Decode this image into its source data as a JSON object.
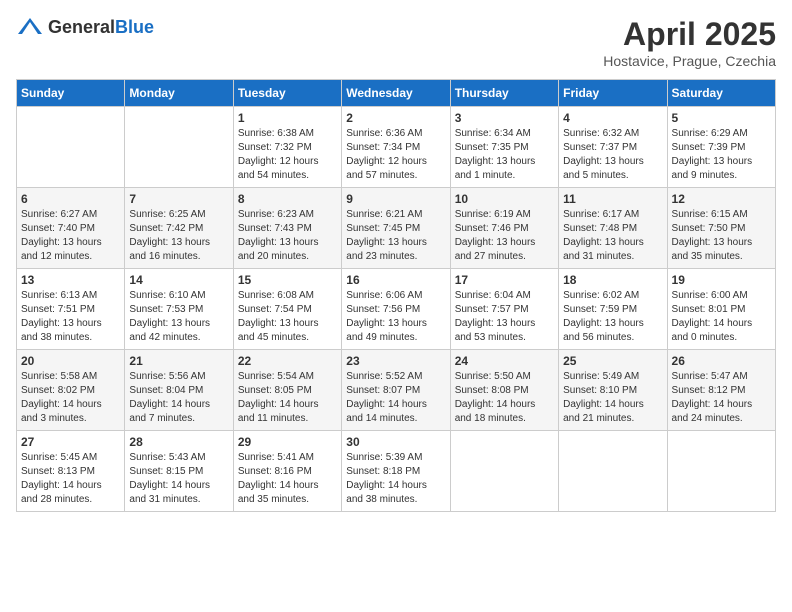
{
  "header": {
    "logo_general": "General",
    "logo_blue": "Blue",
    "main_title": "April 2025",
    "sub_title": "Hostavice, Prague, Czechia"
  },
  "days_of_week": [
    "Sunday",
    "Monday",
    "Tuesday",
    "Wednesday",
    "Thursday",
    "Friday",
    "Saturday"
  ],
  "weeks": [
    [
      {
        "day": "",
        "sunrise": "",
        "sunset": "",
        "daylight": ""
      },
      {
        "day": "",
        "sunrise": "",
        "sunset": "",
        "daylight": ""
      },
      {
        "day": "1",
        "sunrise": "Sunrise: 6:38 AM",
        "sunset": "Sunset: 7:32 PM",
        "daylight": "Daylight: 12 hours and 54 minutes."
      },
      {
        "day": "2",
        "sunrise": "Sunrise: 6:36 AM",
        "sunset": "Sunset: 7:34 PM",
        "daylight": "Daylight: 12 hours and 57 minutes."
      },
      {
        "day": "3",
        "sunrise": "Sunrise: 6:34 AM",
        "sunset": "Sunset: 7:35 PM",
        "daylight": "Daylight: 13 hours and 1 minute."
      },
      {
        "day": "4",
        "sunrise": "Sunrise: 6:32 AM",
        "sunset": "Sunset: 7:37 PM",
        "daylight": "Daylight: 13 hours and 5 minutes."
      },
      {
        "day": "5",
        "sunrise": "Sunrise: 6:29 AM",
        "sunset": "Sunset: 7:39 PM",
        "daylight": "Daylight: 13 hours and 9 minutes."
      }
    ],
    [
      {
        "day": "6",
        "sunrise": "Sunrise: 6:27 AM",
        "sunset": "Sunset: 7:40 PM",
        "daylight": "Daylight: 13 hours and 12 minutes."
      },
      {
        "day": "7",
        "sunrise": "Sunrise: 6:25 AM",
        "sunset": "Sunset: 7:42 PM",
        "daylight": "Daylight: 13 hours and 16 minutes."
      },
      {
        "day": "8",
        "sunrise": "Sunrise: 6:23 AM",
        "sunset": "Sunset: 7:43 PM",
        "daylight": "Daylight: 13 hours and 20 minutes."
      },
      {
        "day": "9",
        "sunrise": "Sunrise: 6:21 AM",
        "sunset": "Sunset: 7:45 PM",
        "daylight": "Daylight: 13 hours and 23 minutes."
      },
      {
        "day": "10",
        "sunrise": "Sunrise: 6:19 AM",
        "sunset": "Sunset: 7:46 PM",
        "daylight": "Daylight: 13 hours and 27 minutes."
      },
      {
        "day": "11",
        "sunrise": "Sunrise: 6:17 AM",
        "sunset": "Sunset: 7:48 PM",
        "daylight": "Daylight: 13 hours and 31 minutes."
      },
      {
        "day": "12",
        "sunrise": "Sunrise: 6:15 AM",
        "sunset": "Sunset: 7:50 PM",
        "daylight": "Daylight: 13 hours and 35 minutes."
      }
    ],
    [
      {
        "day": "13",
        "sunrise": "Sunrise: 6:13 AM",
        "sunset": "Sunset: 7:51 PM",
        "daylight": "Daylight: 13 hours and 38 minutes."
      },
      {
        "day": "14",
        "sunrise": "Sunrise: 6:10 AM",
        "sunset": "Sunset: 7:53 PM",
        "daylight": "Daylight: 13 hours and 42 minutes."
      },
      {
        "day": "15",
        "sunrise": "Sunrise: 6:08 AM",
        "sunset": "Sunset: 7:54 PM",
        "daylight": "Daylight: 13 hours and 45 minutes."
      },
      {
        "day": "16",
        "sunrise": "Sunrise: 6:06 AM",
        "sunset": "Sunset: 7:56 PM",
        "daylight": "Daylight: 13 hours and 49 minutes."
      },
      {
        "day": "17",
        "sunrise": "Sunrise: 6:04 AM",
        "sunset": "Sunset: 7:57 PM",
        "daylight": "Daylight: 13 hours and 53 minutes."
      },
      {
        "day": "18",
        "sunrise": "Sunrise: 6:02 AM",
        "sunset": "Sunset: 7:59 PM",
        "daylight": "Daylight: 13 hours and 56 minutes."
      },
      {
        "day": "19",
        "sunrise": "Sunrise: 6:00 AM",
        "sunset": "Sunset: 8:01 PM",
        "daylight": "Daylight: 14 hours and 0 minutes."
      }
    ],
    [
      {
        "day": "20",
        "sunrise": "Sunrise: 5:58 AM",
        "sunset": "Sunset: 8:02 PM",
        "daylight": "Daylight: 14 hours and 3 minutes."
      },
      {
        "day": "21",
        "sunrise": "Sunrise: 5:56 AM",
        "sunset": "Sunset: 8:04 PM",
        "daylight": "Daylight: 14 hours and 7 minutes."
      },
      {
        "day": "22",
        "sunrise": "Sunrise: 5:54 AM",
        "sunset": "Sunset: 8:05 PM",
        "daylight": "Daylight: 14 hours and 11 minutes."
      },
      {
        "day": "23",
        "sunrise": "Sunrise: 5:52 AM",
        "sunset": "Sunset: 8:07 PM",
        "daylight": "Daylight: 14 hours and 14 minutes."
      },
      {
        "day": "24",
        "sunrise": "Sunrise: 5:50 AM",
        "sunset": "Sunset: 8:08 PM",
        "daylight": "Daylight: 14 hours and 18 minutes."
      },
      {
        "day": "25",
        "sunrise": "Sunrise: 5:49 AM",
        "sunset": "Sunset: 8:10 PM",
        "daylight": "Daylight: 14 hours and 21 minutes."
      },
      {
        "day": "26",
        "sunrise": "Sunrise: 5:47 AM",
        "sunset": "Sunset: 8:12 PM",
        "daylight": "Daylight: 14 hours and 24 minutes."
      }
    ],
    [
      {
        "day": "27",
        "sunrise": "Sunrise: 5:45 AM",
        "sunset": "Sunset: 8:13 PM",
        "daylight": "Daylight: 14 hours and 28 minutes."
      },
      {
        "day": "28",
        "sunrise": "Sunrise: 5:43 AM",
        "sunset": "Sunset: 8:15 PM",
        "daylight": "Daylight: 14 hours and 31 minutes."
      },
      {
        "day": "29",
        "sunrise": "Sunrise: 5:41 AM",
        "sunset": "Sunset: 8:16 PM",
        "daylight": "Daylight: 14 hours and 35 minutes."
      },
      {
        "day": "30",
        "sunrise": "Sunrise: 5:39 AM",
        "sunset": "Sunset: 8:18 PM",
        "daylight": "Daylight: 14 hours and 38 minutes."
      },
      {
        "day": "",
        "sunrise": "",
        "sunset": "",
        "daylight": ""
      },
      {
        "day": "",
        "sunrise": "",
        "sunset": "",
        "daylight": ""
      },
      {
        "day": "",
        "sunrise": "",
        "sunset": "",
        "daylight": ""
      }
    ]
  ]
}
